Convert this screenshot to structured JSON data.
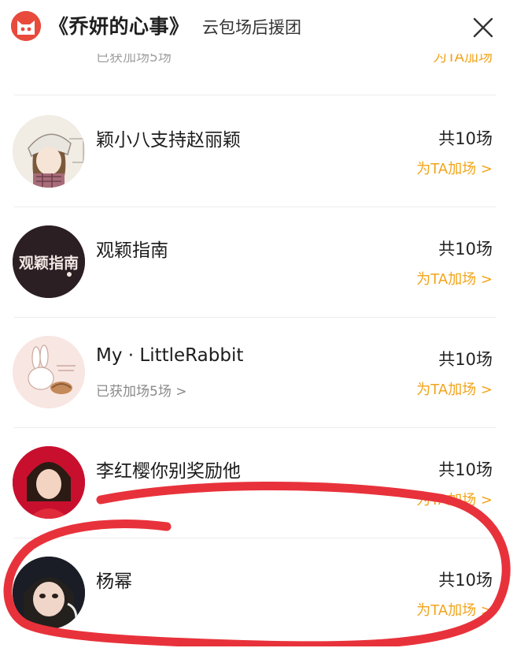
{
  "header": {
    "title": "《乔妍的心事》",
    "subtitle": "云包场后援团",
    "logo_icon": "cat-logo-icon",
    "close_icon": "close-icon"
  },
  "partial_row": {
    "sub": "已获加场5场",
    "action": "为TA加场"
  },
  "rows": [
    {
      "name": "颖小八支持赵丽颖",
      "sub": "",
      "count": "共10场",
      "action": "为TA加场 >"
    },
    {
      "name": "观颖指南",
      "sub": "",
      "count": "共10场",
      "action": "为TA加场 >"
    },
    {
      "name": "My · LittleRabbit",
      "sub": "已获加场5场 >",
      "count": "共10场",
      "action": "为TA加场 >"
    },
    {
      "name": "李红樱你别奖励他",
      "sub": "",
      "count": "共10场",
      "action": "为TA加场 >"
    },
    {
      "name": "杨幂",
      "sub": "",
      "count": "共10场",
      "action": "为TA加场 >"
    }
  ],
  "avatar_2_text": "观颖指南",
  "colors": {
    "accent": "#f2a41c",
    "scribble": "#e8323b",
    "logo": "#e84a3c"
  }
}
